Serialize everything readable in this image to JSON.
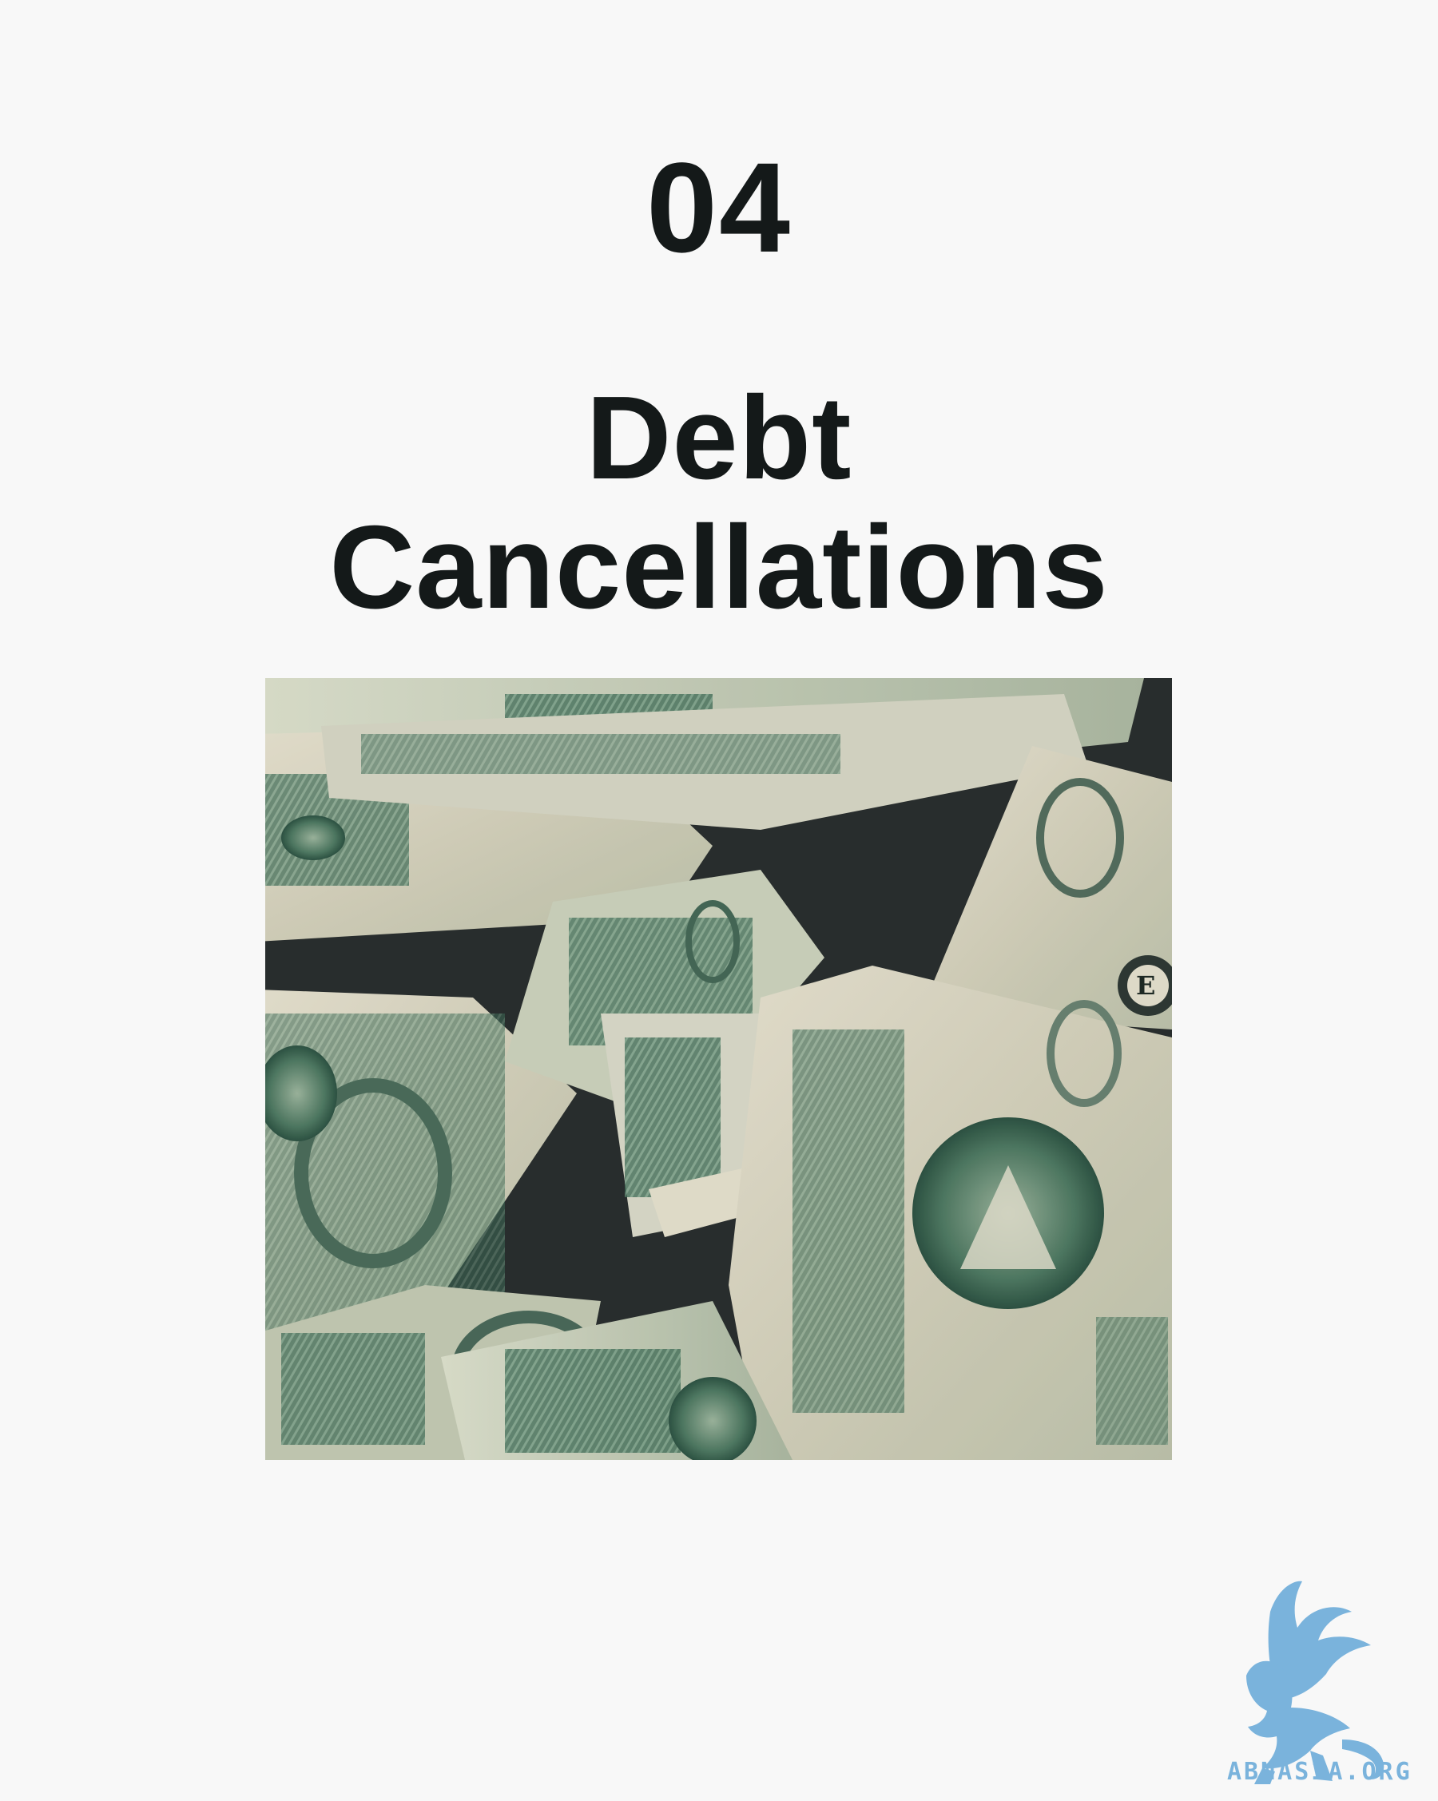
{
  "slide": {
    "number": "04",
    "title_line1": "Debt",
    "title_line2": "Cancellations"
  },
  "photo": {
    "subject": "crumpled US one-dollar bills"
  },
  "brand": {
    "logo_text": "ABNASIA.ORG",
    "logo_icon": "griffin-icon",
    "color": "#7ab3dc"
  },
  "colors": {
    "background": "#f8f8f8",
    "text": "#141919"
  }
}
